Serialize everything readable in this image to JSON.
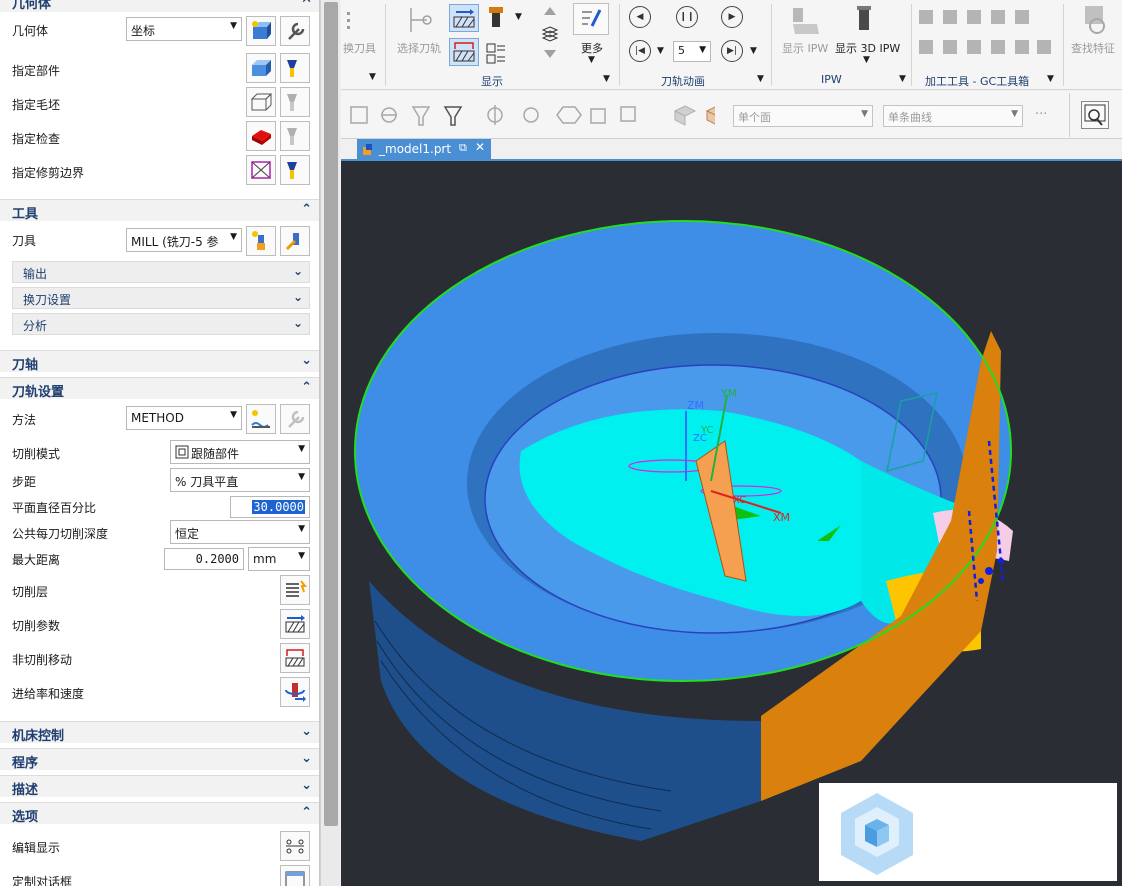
{
  "panel": {
    "geometry": {
      "title": "几何体",
      "geom_label": "几何体",
      "geom_value": "坐标",
      "part_label": "指定部件",
      "blank_label": "指定毛坯",
      "check_label": "指定检查",
      "trim_label": "指定修剪边界"
    },
    "tool": {
      "title": "工具",
      "tool_label": "刀具",
      "tool_value": "MILL (铣刀-5 参",
      "output_label": "输出",
      "change_label": "换刀设置",
      "analysis_label": "分析"
    },
    "axis": {
      "title": "刀轴"
    },
    "path": {
      "title": "刀轨设置",
      "method_label": "方法",
      "method_value": "METHOD",
      "cut_mode_label": "切削模式",
      "cut_mode_value": "跟随部件",
      "step_label": "步距",
      "step_value": "% 刀具平直",
      "pct_label": "平面直径百分比",
      "pct_value": "30.0000",
      "depth_label": "公共每刀切削深度",
      "depth_value": "恒定",
      "max_label": "最大距离",
      "max_value": "0.2000",
      "unit_value": "mm",
      "layers_label": "切削层",
      "params_label": "切削参数",
      "noncut_label": "非切削移动",
      "feeds_label": "进给率和速度"
    },
    "machine": {
      "title": "机床控制"
    },
    "program": {
      "title": "程序"
    },
    "desc": {
      "title": "描述"
    },
    "options": {
      "title": "选项",
      "edit_label": "编辑显示",
      "custom_label": "定制对话框"
    }
  },
  "ribbon": {
    "swap_tool": "换刀具",
    "select_tool": "选择刀轨",
    "more": "更多",
    "display_group": "显示",
    "anim_group": "刀轨动画",
    "anim_speed": "5",
    "show_ipw": "显示 IPW",
    "show_3d_ipw": "显示 3D IPW",
    "ipw_group": "IPW",
    "mfg_group": "加工工具 - GC工具箱",
    "find_feature": "查找特征"
  },
  "toolbar2": {
    "face_filter": "单个面",
    "curve_filter": "单条曲线",
    "more_dots": "···"
  },
  "tab": {
    "label": "_model1.prt"
  },
  "viewport": {
    "labels": {
      "zm": "ZM",
      "ym": "YM",
      "yc": "YC",
      "zc": "ZC",
      "xm": "XM",
      "xc": "XC"
    },
    "colors": {
      "background": "#2a2d34",
      "part_top": "#3e8de6",
      "part_side": "#1e4f8a",
      "toolpath": "#00f0f0",
      "fixture": "#d9800d",
      "blank_outline": "#22dd22",
      "yellow": "#ffc400",
      "pink": "#f6cde6"
    }
  }
}
